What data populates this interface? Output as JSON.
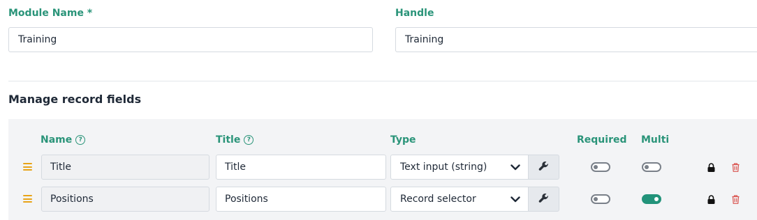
{
  "module": {
    "name_label": "Module Name *",
    "name_value": "Training",
    "handle_label": "Handle",
    "handle_value": "Training"
  },
  "fields_section": {
    "title": "Manage record fields",
    "columns": {
      "name": "Name",
      "title": "Title",
      "type": "Type",
      "required": "Required",
      "multi": "Multi"
    },
    "rows": [
      {
        "name": "Title",
        "title": "Title",
        "type": "Text input (string)",
        "required": false,
        "multi": false
      },
      {
        "name": "Positions",
        "title": "Positions",
        "type": "Record selector",
        "required": false,
        "multi": true
      }
    ]
  },
  "colors": {
    "accent": "#2a9479",
    "toggle_on": "#22937a",
    "drag_handle": "#e8a317",
    "delete": "#d9534f"
  },
  "icons": [
    "help-icon",
    "drag-handle-icon",
    "chevron-down-icon",
    "wrench-icon",
    "lock-icon",
    "trash-icon"
  ]
}
